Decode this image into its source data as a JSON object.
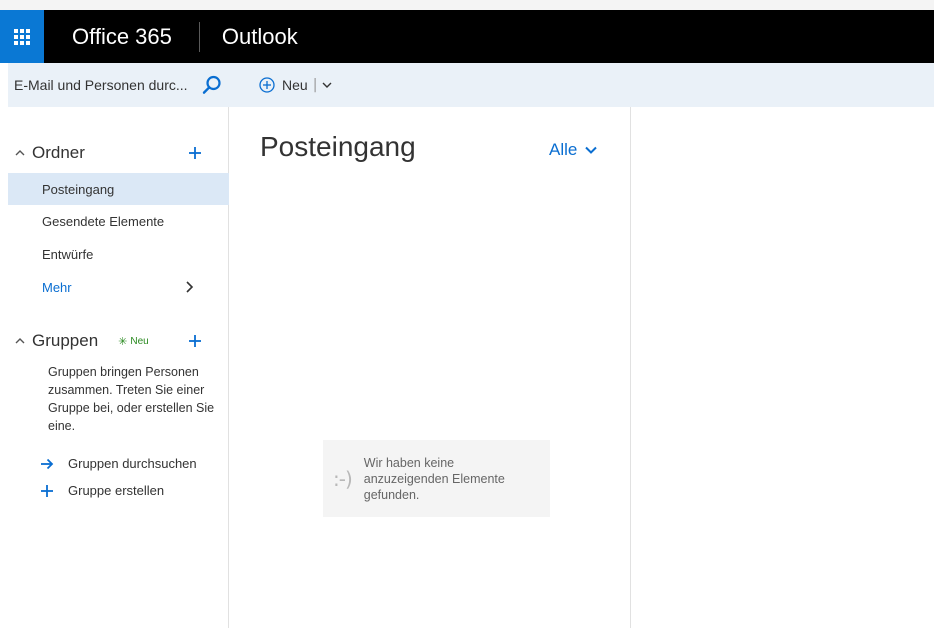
{
  "topbar": {
    "brand": "Office 365",
    "app_name": "Outlook"
  },
  "search": {
    "placeholder": "E-Mail und Personen durc..."
  },
  "command_bar": {
    "new_label": "Neu",
    "separator": "|"
  },
  "folders": {
    "title": "Ordner",
    "items": [
      {
        "label": "Posteingang",
        "selected": true
      },
      {
        "label": "Gesendete Elemente",
        "selected": false
      },
      {
        "label": "Entwürfe",
        "selected": false
      }
    ],
    "more_label": "Mehr"
  },
  "groups": {
    "title": "Gruppen",
    "new_badge": "Neu",
    "description": "Gruppen bringen Personen zusammen. Treten Sie einer Gruppe bei, oder erstellen Sie eine.",
    "actions": [
      {
        "label": "Gruppen durchsuchen",
        "icon": "arrow-right-icon"
      },
      {
        "label": "Gruppe erstellen",
        "icon": "plus-icon"
      }
    ]
  },
  "message_list": {
    "title": "Posteingang",
    "filter_label": "Alle",
    "empty_emoticon": ":-)",
    "empty_message": "Wir haben keine anzuzeigenden Elemente gefunden."
  },
  "colors": {
    "accent": "#0a6ed1",
    "waffle": "#0a78d4",
    "topbar": "#000000",
    "selected": "#dbe8f6",
    "new_badge": "#2a8a20"
  }
}
